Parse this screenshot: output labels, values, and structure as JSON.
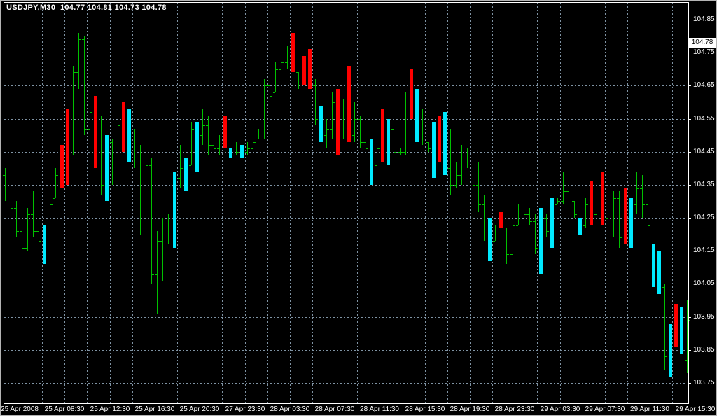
{
  "header": {
    "title": "USDJPY,M30  104.77 104.81 104.73 104.78",
    "symbol": "USDJPY",
    "timeframe": "M30",
    "ohlc": {
      "open": "104.77",
      "high": "104.81",
      "low": "104.73",
      "close": "104.78"
    }
  },
  "price_axis": {
    "labels": [
      "104.85",
      "104.75",
      "104.65",
      "104.55",
      "104.45",
      "104.35",
      "104.25",
      "104.15",
      "104.05",
      "103.95",
      "103.85",
      "103.75"
    ],
    "current_label": "104.78"
  },
  "time_axis": {
    "labels": [
      "25 Apr 2008",
      "25 Apr 08:30",
      "25 Apr 12:30",
      "25 Apr 16:30",
      "25 Apr 20:30",
      "27 Apr 23:30",
      "28 Apr 03:30",
      "28 Apr 07:30",
      "28 Apr 11:30",
      "28 Apr 15:30",
      "28 Apr 19:30",
      "28 Apr 23:30",
      "29 Apr 03:30",
      "29 Apr 07:30",
      "29 Apr 11:30",
      "29 Apr 15:30"
    ]
  },
  "colors": {
    "background": "#000000",
    "window_border": "#b4b4b4",
    "frame": "#ffffff",
    "grid": "#7f93a4",
    "text": "#ffffff",
    "bar_green": "#00c000",
    "bar_red": "#ff0000",
    "bar_aqua": "#00eaff",
    "price_line": "#a9b7c6",
    "tag_bg": "#ffffff",
    "tag_text": "#000000"
  },
  "chart_data": {
    "type": "ohlc-bar",
    "title": "USDJPY,M30",
    "symbol": "USDJPY",
    "timeframe": "M30",
    "current_price": 104.78,
    "y_max": 104.85,
    "y_min": 103.75,
    "price_grid_step": 0.1,
    "x_tick_labels": [
      "25 Apr 2008",
      "25 Apr 08:30",
      "25 Apr 12:30",
      "25 Apr 16:30",
      "25 Apr 20:30",
      "27 Apr 23:30",
      "28 Apr 03:30",
      "28 Apr 07:30",
      "28 Apr 11:30",
      "28 Apr 15:30",
      "28 Apr 19:30",
      "28 Apr 23:30",
      "29 Apr 03:30",
      "29 Apr 07:30",
      "29 Apr 11:30",
      "29 Apr 15:30"
    ],
    "bars_per_x_tick": 8,
    "legend": {
      "g": "up-bar green",
      "r": "highlighted red bar",
      "c": "highlighted aqua bar"
    },
    "bars": [
      [
        "g",
        104.4,
        104.3,
        104.38,
        104.32
      ],
      [
        "g",
        104.38,
        104.26,
        104.32,
        104.28
      ],
      [
        "g",
        104.3,
        104.19,
        104.28,
        104.21
      ],
      [
        "g",
        104.27,
        104.13,
        104.21,
        104.16
      ],
      [
        "g",
        104.28,
        104.15,
        104.16,
        104.26
      ],
      [
        "g",
        104.33,
        104.19,
        104.26,
        104.21
      ],
      [
        "g",
        104.27,
        104.16,
        104.21,
        104.18
      ],
      [
        "c",
        104.23,
        104.11,
        104.2,
        104.13
      ],
      [
        "g",
        104.31,
        104.19,
        104.2,
        104.29
      ],
      [
        "g",
        104.4,
        104.31,
        104.31,
        104.38
      ],
      [
        "r",
        104.47,
        104.34,
        104.35,
        104.45
      ],
      [
        "r",
        104.58,
        104.35,
        104.45,
        104.56
      ],
      [
        "g",
        104.71,
        104.44,
        104.56,
        104.69
      ],
      [
        "g",
        104.81,
        104.64,
        104.69,
        104.79
      ],
      [
        "g",
        104.8,
        104.5,
        104.79,
        104.52
      ],
      [
        "g",
        104.6,
        104.41,
        104.52,
        104.57
      ],
      [
        "r",
        104.62,
        104.4,
        104.57,
        104.42
      ],
      [
        "g",
        104.56,
        104.32,
        104.42,
        104.35
      ],
      [
        "c",
        104.5,
        104.3,
        104.35,
        104.48
      ],
      [
        "g",
        104.49,
        104.35,
        104.48,
        104.44
      ],
      [
        "g",
        104.55,
        104.43,
        104.44,
        104.53
      ],
      [
        "r",
        104.6,
        104.45,
        104.53,
        104.47
      ],
      [
        "c",
        104.58,
        104.42,
        104.47,
        104.44
      ],
      [
        "g",
        104.52,
        104.4,
        104.44,
        104.42
      ],
      [
        "g",
        104.47,
        104.2,
        104.42,
        104.22
      ],
      [
        "g",
        104.43,
        104.2,
        104.22,
        104.41
      ],
      [
        "g",
        104.43,
        104.05,
        104.41,
        104.08
      ],
      [
        "g",
        104.21,
        103.96,
        104.08,
        104.18
      ],
      [
        "g",
        104.25,
        104.06,
        104.18,
        104.2
      ],
      [
        "g",
        104.26,
        104.17,
        104.2,
        104.22
      ],
      [
        "c",
        104.39,
        104.16,
        104.22,
        104.37
      ],
      [
        "g",
        104.47,
        104.34,
        104.37,
        104.4
      ],
      [
        "c",
        104.43,
        104.33,
        104.4,
        104.41
      ],
      [
        "g",
        104.54,
        104.41,
        104.41,
        104.52
      ],
      [
        "c",
        104.54,
        104.39,
        104.52,
        104.5
      ],
      [
        "g",
        104.58,
        104.47,
        104.5,
        104.53
      ],
      [
        "g",
        104.56,
        104.44,
        104.53,
        104.47
      ],
      [
        "g",
        104.53,
        104.41,
        104.47,
        104.46
      ],
      [
        "g",
        104.5,
        104.44,
        104.46,
        104.49
      ],
      [
        "r",
        104.56,
        104.46,
        104.49,
        104.5
      ],
      [
        "c",
        104.46,
        104.43,
        104.46,
        104.44
      ],
      [
        "g",
        104.48,
        104.44,
        104.44,
        104.45
      ],
      [
        "c",
        104.47,
        104.43,
        104.45,
        104.45
      ],
      [
        "g",
        104.48,
        104.44,
        104.45,
        104.46
      ],
      [
        "g",
        104.49,
        104.45,
        104.46,
        104.48
      ],
      [
        "g",
        104.52,
        104.49,
        104.49,
        104.51
      ],
      [
        "g",
        104.67,
        104.49,
        104.51,
        104.65
      ],
      [
        "g",
        104.67,
        104.59,
        104.65,
        104.62
      ],
      [
        "g",
        104.72,
        104.63,
        104.63,
        104.7
      ],
      [
        "g",
        104.74,
        104.66,
        104.7,
        104.72
      ],
      [
        "g",
        104.77,
        104.7,
        104.72,
        104.75
      ],
      [
        "r",
        104.81,
        104.69,
        104.75,
        104.7
      ],
      [
        "g",
        104.69,
        104.64,
        104.69,
        104.66
      ],
      [
        "r",
        104.74,
        104.65,
        104.66,
        104.68
      ],
      [
        "r",
        104.76,
        104.64,
        104.68,
        104.65
      ],
      [
        "g",
        104.67,
        104.53,
        104.65,
        104.55
      ],
      [
        "c",
        104.59,
        104.48,
        104.55,
        104.5
      ],
      [
        "g",
        104.55,
        104.46,
        104.5,
        104.52
      ],
      [
        "g",
        104.63,
        104.49,
        104.52,
        104.6
      ],
      [
        "r",
        104.64,
        104.44,
        104.6,
        104.46
      ],
      [
        "g",
        104.61,
        104.49,
        104.49,
        104.58
      ],
      [
        "r",
        104.71,
        104.48,
        104.58,
        104.5
      ],
      [
        "g",
        104.6,
        104.48,
        104.5,
        104.55
      ],
      [
        "g",
        104.56,
        104.46,
        104.55,
        104.48
      ],
      [
        "g",
        104.48,
        104.45,
        104.48,
        104.46
      ],
      [
        "c",
        104.49,
        104.35,
        104.46,
        104.37
      ],
      [
        "g",
        104.48,
        104.41,
        104.41,
        104.46
      ],
      [
        "r",
        104.58,
        104.42,
        104.46,
        104.44
      ],
      [
        "c",
        104.55,
        104.41,
        104.44,
        104.52
      ],
      [
        "g",
        104.52,
        104.43,
        104.52,
        104.45
      ],
      [
        "g",
        104.46,
        104.44,
        104.45,
        104.45
      ],
      [
        "g",
        104.63,
        104.44,
        104.45,
        104.61
      ],
      [
        "r",
        104.7,
        104.55,
        104.61,
        104.57
      ],
      [
        "c",
        104.64,
        104.48,
        104.57,
        104.62
      ],
      [
        "g",
        104.58,
        104.47,
        104.58,
        104.49
      ],
      [
        "g",
        104.48,
        104.45,
        104.48,
        104.46
      ],
      [
        "c",
        104.54,
        104.37,
        104.46,
        104.39
      ],
      [
        "r",
        104.56,
        104.42,
        104.42,
        104.44
      ],
      [
        "c",
        104.57,
        104.38,
        104.44,
        104.4
      ],
      [
        "g",
        104.52,
        104.32,
        104.4,
        104.35
      ],
      [
        "g",
        104.42,
        104.34,
        104.35,
        104.38
      ],
      [
        "g",
        104.47,
        104.35,
        104.38,
        104.42
      ],
      [
        "g",
        104.46,
        104.4,
        104.42,
        104.42
      ],
      [
        "g",
        104.43,
        104.33,
        104.42,
        104.35
      ],
      [
        "g",
        104.42,
        104.27,
        104.35,
        104.29
      ],
      [
        "g",
        104.32,
        104.18,
        104.29,
        104.2
      ],
      [
        "c",
        104.25,
        104.12,
        104.2,
        104.15
      ],
      [
        "g",
        104.23,
        104.18,
        104.18,
        104.22
      ],
      [
        "r",
        104.27,
        104.22,
        104.22,
        104.23
      ],
      [
        "g",
        104.22,
        104.11,
        104.22,
        104.14
      ],
      [
        "g",
        104.25,
        104.14,
        104.14,
        104.23
      ],
      [
        "g",
        104.29,
        104.23,
        104.23,
        104.27
      ],
      [
        "g",
        104.29,
        104.24,
        104.27,
        104.26
      ],
      [
        "g",
        104.28,
        104.23,
        104.26,
        104.24
      ],
      [
        "g",
        104.26,
        104.14,
        104.24,
        104.16
      ],
      [
        "c",
        104.28,
        104.08,
        104.16,
        104.25
      ],
      [
        "g",
        104.26,
        104.19,
        104.25,
        104.21
      ],
      [
        "c",
        104.31,
        104.16,
        104.21,
        104.29
      ],
      [
        "g",
        104.31,
        104.29,
        104.29,
        104.3
      ],
      [
        "g",
        104.39,
        104.29,
        104.3,
        104.33
      ],
      [
        "g",
        104.34,
        104.31,
        104.33,
        104.32
      ],
      [
        "g",
        104.3,
        104.25,
        104.3,
        104.26
      ],
      [
        "c",
        104.25,
        104.2,
        104.25,
        104.23
      ],
      [
        "g",
        104.31,
        104.22,
        104.23,
        104.29
      ],
      [
        "r",
        104.36,
        104.23,
        104.29,
        104.25
      ],
      [
        "g",
        104.34,
        104.26,
        104.26,
        104.32
      ],
      [
        "r",
        104.39,
        104.23,
        104.32,
        104.25
      ],
      [
        "g",
        104.26,
        104.15,
        104.25,
        104.2
      ],
      [
        "g",
        104.33,
        104.19,
        104.2,
        104.31
      ],
      [
        "g",
        104.33,
        104.16,
        104.31,
        104.19
      ],
      [
        "r",
        104.34,
        104.17,
        104.19,
        104.19
      ],
      [
        "c",
        104.31,
        104.16,
        104.19,
        104.29
      ],
      [
        "g",
        104.39,
        104.26,
        104.29,
        104.34
      ],
      [
        "g",
        104.38,
        104.25,
        104.34,
        104.29
      ],
      [
        "g",
        104.36,
        104.21,
        104.29,
        104.23
      ],
      [
        "c",
        104.17,
        104.04,
        104.17,
        104.06
      ],
      [
        "c",
        104.15,
        104.02,
        104.06,
        104.04
      ],
      [
        "g",
        104.05,
        103.79,
        104.04,
        103.83
      ],
      [
        "c",
        103.93,
        103.77,
        103.83,
        103.9
      ],
      [
        "r",
        103.99,
        103.86,
        103.9,
        103.88
      ],
      [
        "c",
        103.98,
        103.84,
        103.88,
        103.96
      ],
      [
        "g",
        104.0,
        103.78,
        103.82,
        103.94
      ]
    ]
  }
}
